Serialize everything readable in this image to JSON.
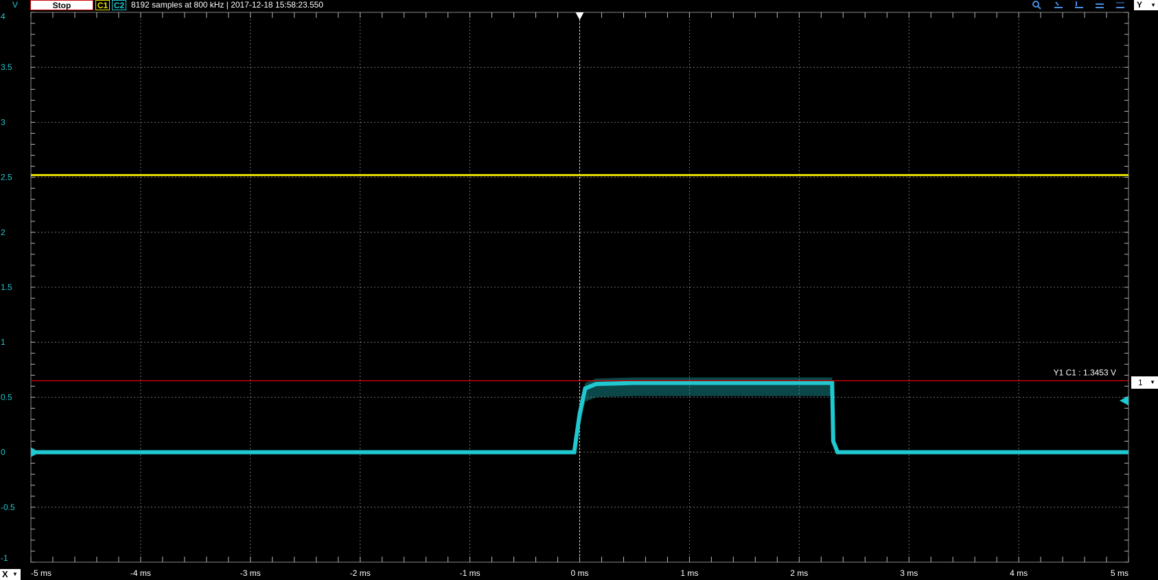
{
  "toolbar": {
    "y_unit": "V",
    "stop_label": "Stop",
    "c1_label": "C1",
    "c2_label": "C2",
    "info": "8192 samples at 800 kHz | 2017-12-18 15:58:23.550",
    "y_menu_label": "Y",
    "icons": [
      "zoom-icon",
      "zoom-fit-icon",
      "zoom-in-icon",
      "zoom-out-icon",
      "zoom-reset-icon",
      "settings-icon"
    ]
  },
  "x_menu_label": "X",
  "cursor": {
    "label": "Y1 C1 : 1.3453 V",
    "box_label": "1",
    "color": "#e00000",
    "y_value": 0.65
  },
  "colors": {
    "c1": "#e8e000",
    "c2": "#20c8d0",
    "grid": "#8a8a8a",
    "cursor": "#e00000"
  },
  "chart_data": {
    "type": "line",
    "xlim": [
      -5,
      5
    ],
    "ylim": [
      -1,
      4
    ],
    "x_ticks": [
      -5,
      -4,
      -3,
      -2,
      -1,
      0,
      1,
      2,
      3,
      4,
      5
    ],
    "x_tick_labels": [
      "-5 ms",
      "-4 ms",
      "-3 ms",
      "-2 ms",
      "-1 ms",
      "0 ms",
      "1 ms",
      "2 ms",
      "3 ms",
      "4 ms",
      "5 ms"
    ],
    "y_ticks": [
      4,
      3.5,
      3,
      2.5,
      2,
      1.5,
      1,
      0.5,
      0,
      -0.5,
      -1
    ],
    "y_tick_labels": [
      "4",
      "3.5",
      "3",
      "2.5",
      "2",
      "1.5",
      "1",
      "0.5",
      "0",
      "-0.5",
      "-1"
    ],
    "y_unit": "V",
    "grid": true,
    "trigger_x": 0,
    "series": [
      {
        "name": "C1",
        "color": "#e8e000",
        "x": [
          -5,
          0,
          5
        ],
        "y": [
          2.52,
          2.52,
          2.52
        ]
      },
      {
        "name": "C2",
        "color": "#20c8d0",
        "x": [
          -5,
          -0.05,
          0,
          0.05,
          0.15,
          0.5,
          1,
          1.5,
          2,
          2.3,
          2.31,
          2.35,
          5
        ],
        "y": [
          0,
          0,
          0.35,
          0.58,
          0.62,
          0.63,
          0.63,
          0.63,
          0.63,
          0.63,
          0.1,
          0,
          0
        ]
      }
    ]
  }
}
